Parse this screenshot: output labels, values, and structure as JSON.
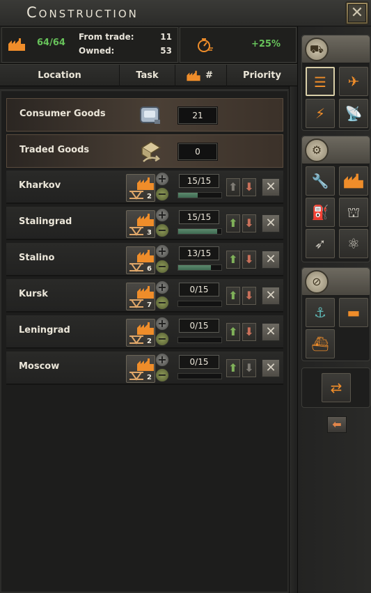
{
  "window": {
    "title": "Construction",
    "close_icon": "close-icon"
  },
  "stats": {
    "factories": "64/64",
    "from_trade_label": "From trade:",
    "from_trade_value": "11",
    "owned_label": "Owned:",
    "owned_value": "53",
    "speed_bonus": "+25%"
  },
  "columns": {
    "location": "Location",
    "task": "Task",
    "factories_count": "#",
    "priority": "Priority"
  },
  "special_rows": [
    {
      "name": "Consumer Goods",
      "icon": "consumer-goods-icon",
      "count": "21"
    },
    {
      "name": "Traded Goods",
      "icon": "traded-goods-icon",
      "count": "0"
    }
  ],
  "queue": [
    {
      "location": "Kharkov",
      "task": "civilian-factory",
      "factories": "2",
      "progress_text": "15/15",
      "progress": 0.45,
      "up_enabled": false,
      "down_enabled": true
    },
    {
      "location": "Stalingrad",
      "task": "civilian-factory",
      "factories": "3",
      "progress_text": "15/15",
      "progress": 0.9,
      "up_enabled": true,
      "down_enabled": true
    },
    {
      "location": "Stalino",
      "task": "civilian-factory",
      "factories": "6",
      "progress_text": "13/15",
      "progress": 0.75,
      "up_enabled": true,
      "down_enabled": true
    },
    {
      "location": "Kursk",
      "task": "civilian-factory",
      "factories": "7",
      "progress_text": "0/15",
      "progress": 0.0,
      "up_enabled": true,
      "down_enabled": true
    },
    {
      "location": "Leningrad",
      "task": "civilian-factory",
      "factories": "2",
      "progress_text": "0/15",
      "progress": 0.0,
      "up_enabled": true,
      "down_enabled": true
    },
    {
      "location": "Moscow",
      "task": "civilian-factory",
      "factories": "2",
      "progress_text": "0/15",
      "progress": 0.0,
      "up_enabled": true,
      "down_enabled": false
    }
  ],
  "colors": {
    "accent_orange": "#ef8d2a",
    "positive_green": "#67c25a",
    "progress_fill": "#4f7d62"
  },
  "sidebar": {
    "groups": [
      {
        "name": "infrastructure",
        "icon": "infrastructure-icon",
        "buttons": [
          "railway-icon",
          "air-base-icon",
          "anti-air-icon",
          "radar-icon"
        ]
      },
      {
        "name": "industry",
        "icon": "industry-icon",
        "buttons": [
          "military-factory-icon",
          "civilian-factory-icon",
          "synthetic-refinery-icon",
          "fuel-silo-icon",
          "rocket-site-icon",
          "nuclear-reactor-icon"
        ]
      },
      {
        "name": "naval",
        "icon": "naval-icon",
        "buttons": [
          "naval-base-icon",
          "coastal-fort-icon",
          "dockyard-icon"
        ]
      },
      {
        "name": "conversion",
        "icon": "conversion-icon",
        "buttons": [
          "convert-factory-icon"
        ]
      }
    ]
  }
}
